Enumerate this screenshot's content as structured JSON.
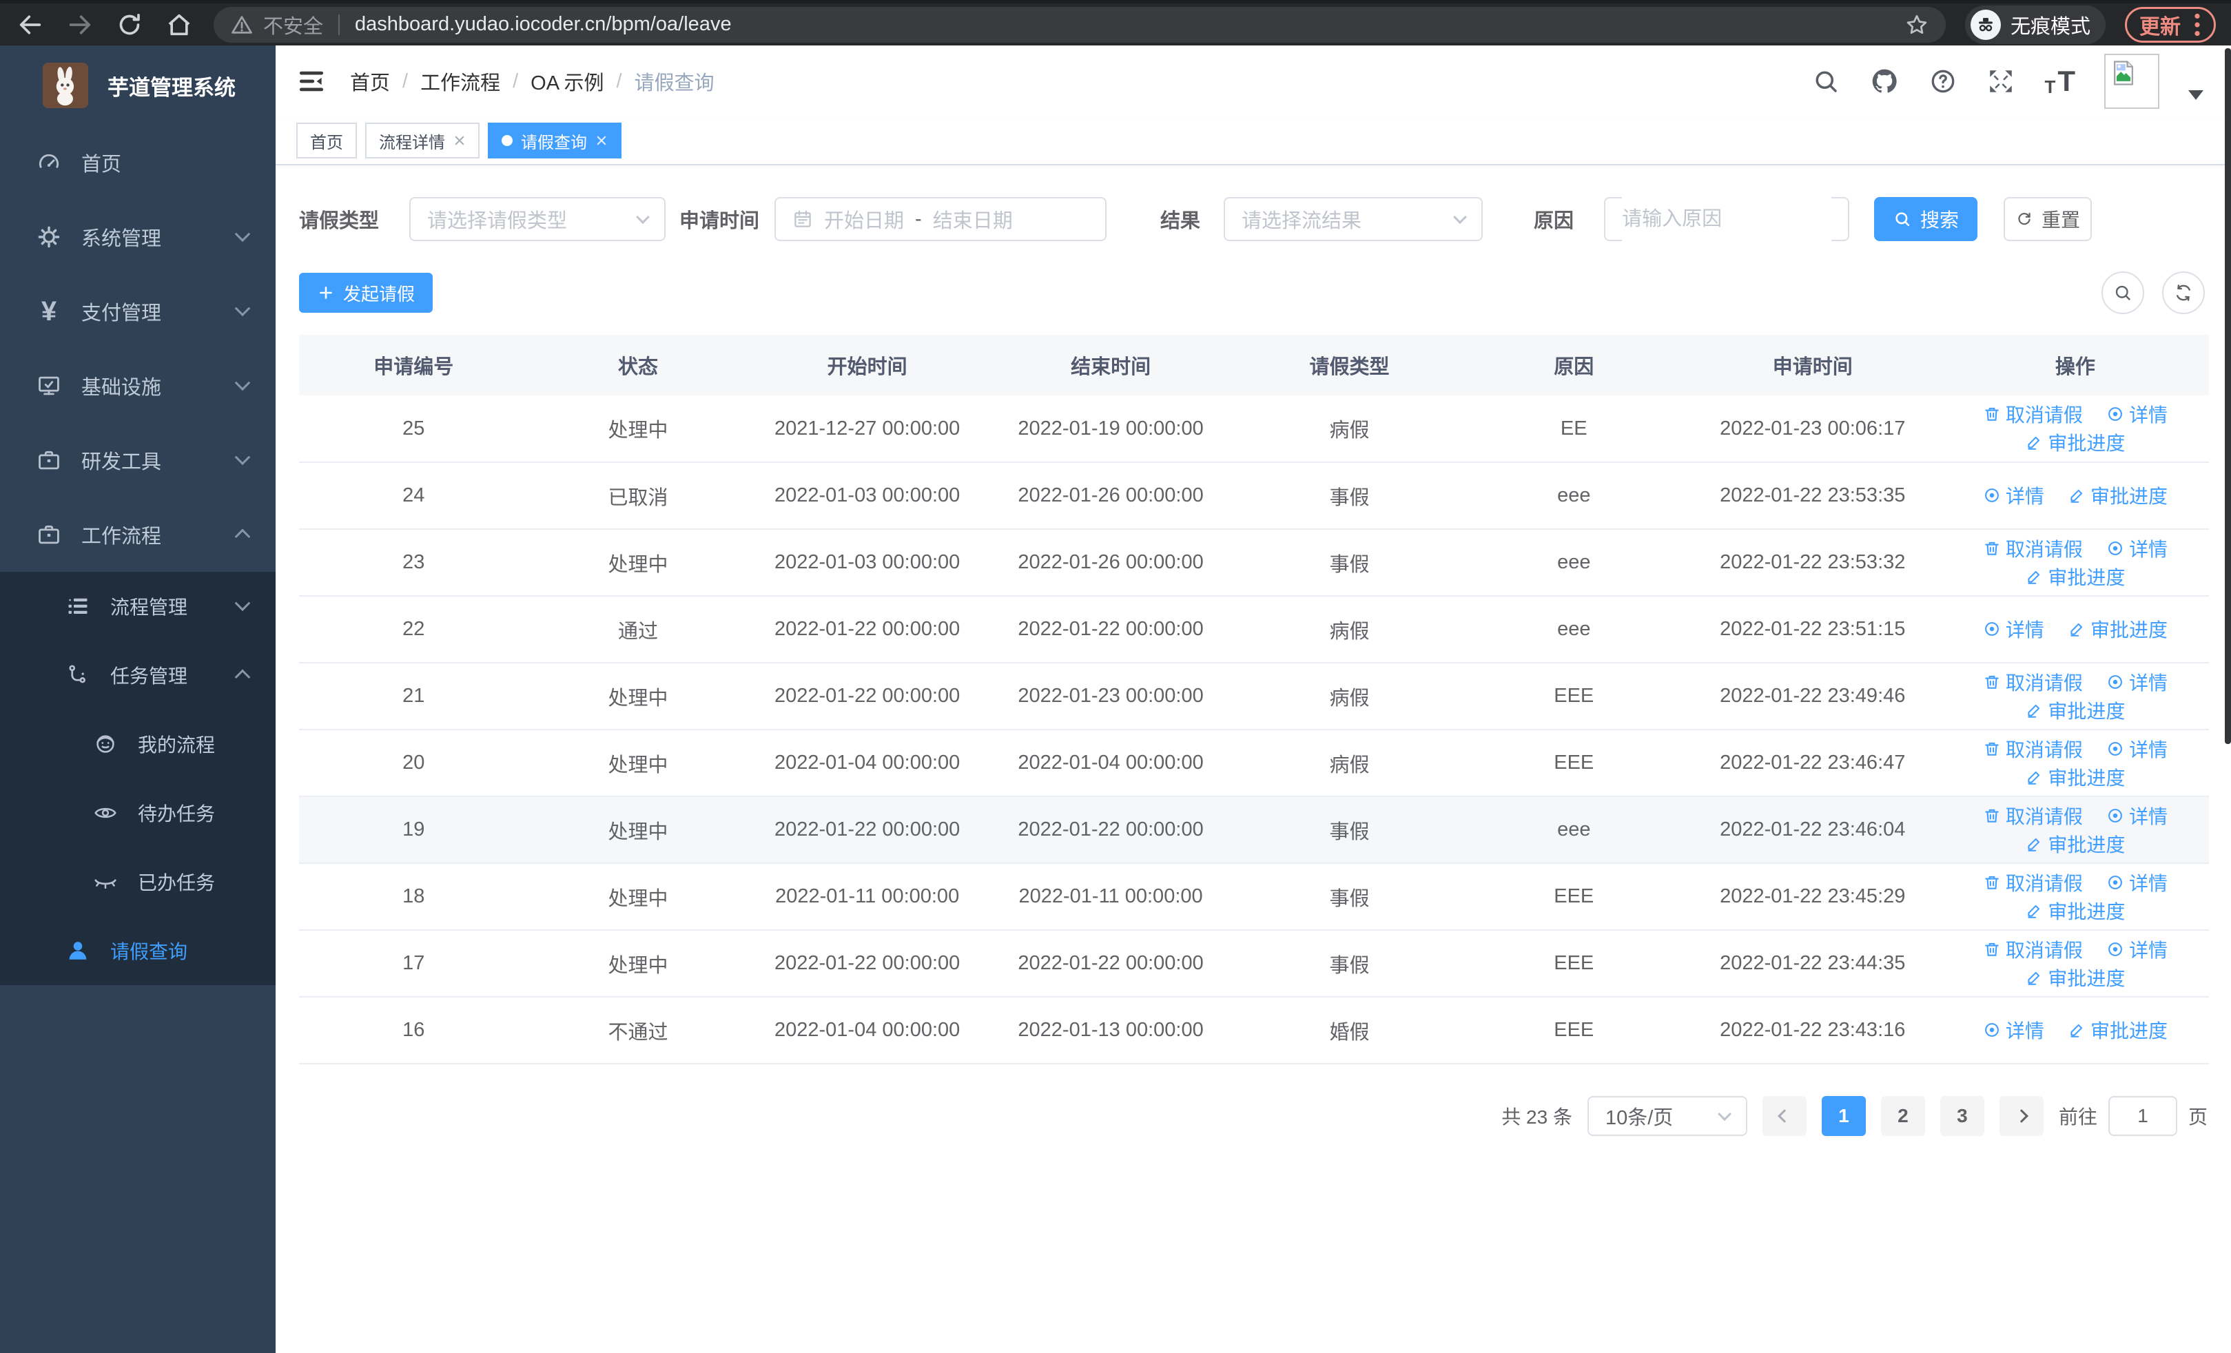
{
  "browser": {
    "security_label": "不安全",
    "url": "dashboard.yudao.iocoder.cn/bpm/oa/leave",
    "incognito_label": "无痕模式",
    "update_label": "更新"
  },
  "sidebar": {
    "title": "芋道管理系统",
    "items": [
      {
        "label": "首页"
      },
      {
        "label": "系统管理"
      },
      {
        "label": "支付管理"
      },
      {
        "label": "基础设施"
      },
      {
        "label": "研发工具"
      },
      {
        "label": "工作流程"
      },
      {
        "label": "流程管理"
      },
      {
        "label": "任务管理"
      },
      {
        "label": "我的流程"
      },
      {
        "label": "待办任务"
      },
      {
        "label": "已办任务"
      },
      {
        "label": "请假查询"
      }
    ]
  },
  "breadcrumb": [
    "首页",
    "工作流程",
    "OA 示例",
    "请假查询"
  ],
  "breadcrumb_separator": "/",
  "tags": [
    {
      "label": "首页"
    },
    {
      "label": "流程详情"
    },
    {
      "label": "请假查询"
    }
  ],
  "filters": {
    "type_label": "请假类型",
    "type_placeholder": "请选择请假类型",
    "time_label": "申请时间",
    "time_start_placeholder": "开始日期",
    "time_separator": "-",
    "time_end_placeholder": "结束日期",
    "result_label": "结果",
    "result_placeholder": "请选择流结果",
    "reason_label": "原因",
    "reason_placeholder": "请输入原因",
    "search_label": "搜索",
    "reset_label": "重置"
  },
  "toolbar": {
    "create_label": "发起请假"
  },
  "table": {
    "columns": [
      "申请编号",
      "状态",
      "开始时间",
      "结束时间",
      "请假类型",
      "原因",
      "申请时间",
      "操作"
    ],
    "action_labels": {
      "cancel": "取消请假",
      "detail": "详情",
      "progress": "审批进度"
    },
    "rows": [
      {
        "id": "25",
        "status": "处理中",
        "start": "2021-12-27 00:00:00",
        "end": "2022-01-19 00:00:00",
        "type": "病假",
        "reason": "EE",
        "apply": "2022-01-23 00:06:17",
        "actions": [
          "cancel",
          "detail",
          "progress"
        ]
      },
      {
        "id": "24",
        "status": "已取消",
        "start": "2022-01-03 00:00:00",
        "end": "2022-01-26 00:00:00",
        "type": "事假",
        "reason": "eee",
        "apply": "2022-01-22 23:53:35",
        "actions": [
          "detail",
          "progress"
        ]
      },
      {
        "id": "23",
        "status": "处理中",
        "start": "2022-01-03 00:00:00",
        "end": "2022-01-26 00:00:00",
        "type": "事假",
        "reason": "eee",
        "apply": "2022-01-22 23:53:32",
        "actions": [
          "cancel",
          "detail",
          "progress"
        ]
      },
      {
        "id": "22",
        "status": "通过",
        "start": "2022-01-22 00:00:00",
        "end": "2022-01-22 00:00:00",
        "type": "病假",
        "reason": "eee",
        "apply": "2022-01-22 23:51:15",
        "actions": [
          "detail",
          "progress"
        ]
      },
      {
        "id": "21",
        "status": "处理中",
        "start": "2022-01-22 00:00:00",
        "end": "2022-01-23 00:00:00",
        "type": "病假",
        "reason": "EEE",
        "apply": "2022-01-22 23:49:46",
        "actions": [
          "cancel",
          "detail",
          "progress"
        ]
      },
      {
        "id": "20",
        "status": "处理中",
        "start": "2022-01-04 00:00:00",
        "end": "2022-01-04 00:00:00",
        "type": "病假",
        "reason": "EEE",
        "apply": "2022-01-22 23:46:47",
        "actions": [
          "cancel",
          "detail",
          "progress"
        ]
      },
      {
        "id": "19",
        "status": "处理中",
        "start": "2022-01-22 00:00:00",
        "end": "2022-01-22 00:00:00",
        "type": "事假",
        "reason": "eee",
        "apply": "2022-01-22 23:46:04",
        "actions": [
          "cancel",
          "detail",
          "progress"
        ],
        "hover": true
      },
      {
        "id": "18",
        "status": "处理中",
        "start": "2022-01-11 00:00:00",
        "end": "2022-01-11 00:00:00",
        "type": "事假",
        "reason": "EEE",
        "apply": "2022-01-22 23:45:29",
        "actions": [
          "cancel",
          "detail",
          "progress"
        ]
      },
      {
        "id": "17",
        "status": "处理中",
        "start": "2022-01-22 00:00:00",
        "end": "2022-01-22 00:00:00",
        "type": "事假",
        "reason": "EEE",
        "apply": "2022-01-22 23:44:35",
        "actions": [
          "cancel",
          "detail",
          "progress"
        ]
      },
      {
        "id": "16",
        "status": "不通过",
        "start": "2022-01-04 00:00:00",
        "end": "2022-01-13 00:00:00",
        "type": "婚假",
        "reason": "EEE",
        "apply": "2022-01-22 23:43:16",
        "actions": [
          "detail",
          "progress"
        ]
      }
    ]
  },
  "pagination": {
    "total": "共 23 条",
    "page_size": "10条/页",
    "pages": [
      "1",
      "2",
      "3"
    ],
    "active_page": "1",
    "goto_label": "前往",
    "goto_value": "1",
    "goto_suffix": "页"
  },
  "colors": {
    "primary": "#409eff",
    "sidebar_bg": "#304156",
    "submenu_bg": "#1f2d3d",
    "update_accent": "#f08b82"
  }
}
